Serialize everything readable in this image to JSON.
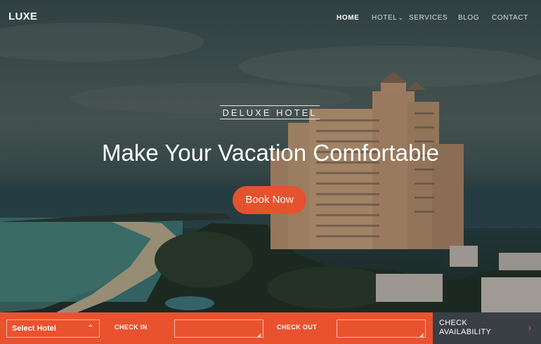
{
  "brand": {
    "logo": "LUXE"
  },
  "nav": {
    "items": [
      {
        "label": "HOME",
        "active": true
      },
      {
        "label": "HOTEL",
        "has_dropdown": true
      },
      {
        "label": "SERVICES"
      },
      {
        "label": "BLOG"
      },
      {
        "label": "CONTACT"
      }
    ]
  },
  "hero": {
    "subtitle": "DELUXE HOTEL",
    "headline": "Make Your Vacation Comfortable",
    "cta_label": "Book Now"
  },
  "booking_bar": {
    "select_hotel": {
      "value": "Select Hotel",
      "icon": "chevron-up-icon"
    },
    "check_in_label": "CHECK IN",
    "check_in_value": "",
    "check_out_label": "CHECK OUT",
    "check_out_value": "",
    "check_availability_label": "CHECK AVAILABILITY",
    "arrow_icon": "chevron-right-icon"
  },
  "colors": {
    "accent": "#e9522f",
    "button": "#e5522e",
    "dark_panel": "#3a3e45"
  }
}
